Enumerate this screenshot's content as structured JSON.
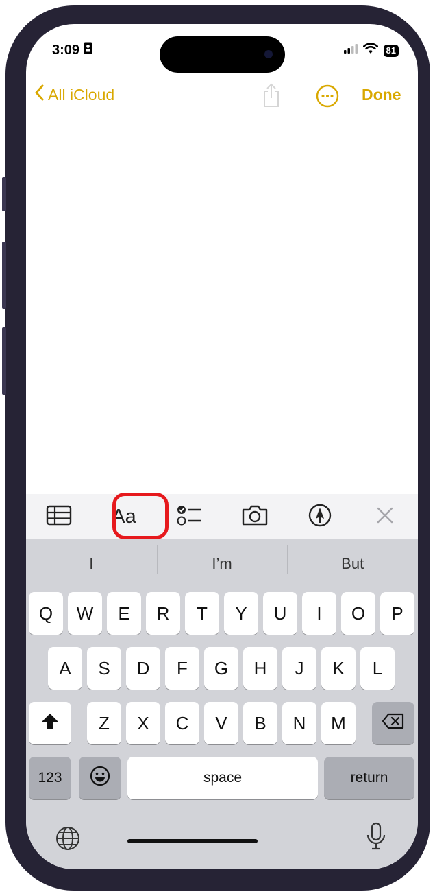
{
  "status": {
    "time": "3:09",
    "battery": "81"
  },
  "nav": {
    "back_label": "All iCloud",
    "done_label": "Done"
  },
  "toolbar": {
    "format_label": "Aa"
  },
  "suggestions": [
    "I",
    "I’m",
    "But"
  ],
  "keys": {
    "row1": [
      "Q",
      "W",
      "E",
      "R",
      "T",
      "Y",
      "U",
      "I",
      "O",
      "P"
    ],
    "row2": [
      "A",
      "S",
      "D",
      "F",
      "G",
      "H",
      "J",
      "K",
      "L"
    ],
    "row3": [
      "Z",
      "X",
      "C",
      "V",
      "B",
      "N",
      "M"
    ],
    "numbers_label": "123",
    "space_label": "space",
    "return_label": "return"
  },
  "accent": "#d9a800",
  "highlight_color": "#e6191d"
}
